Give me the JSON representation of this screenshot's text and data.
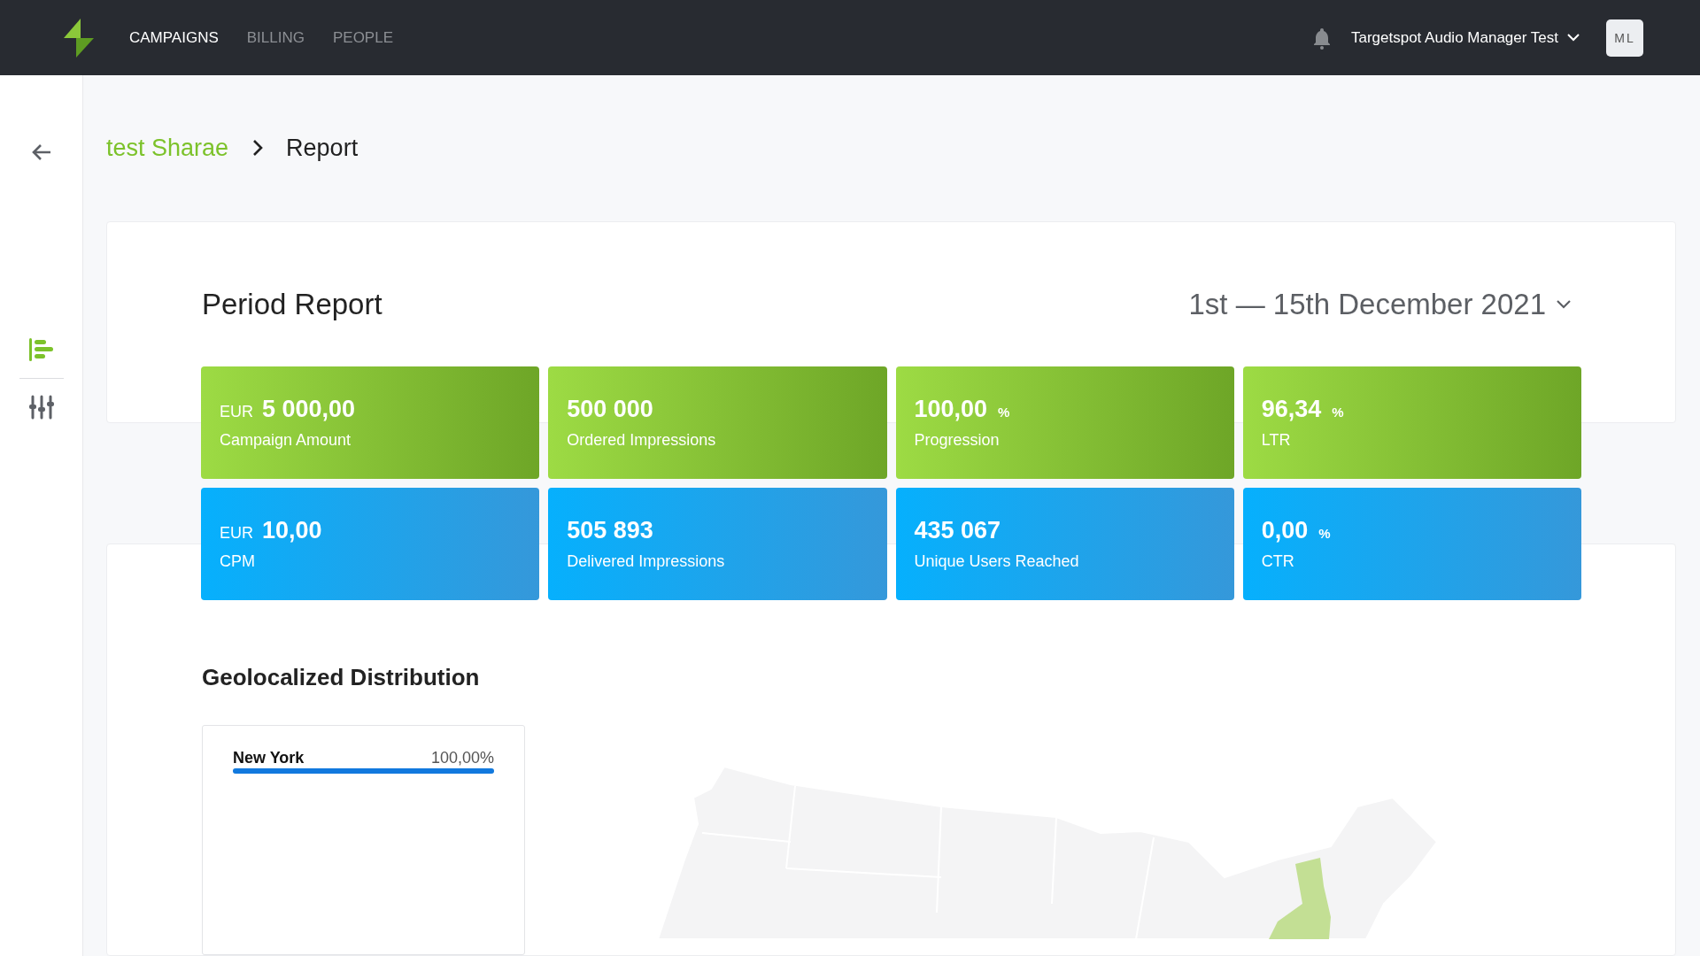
{
  "top_nav": {
    "tabs": [
      {
        "label": "CAMPAIGNS",
        "selected": true
      },
      {
        "label": "BILLING",
        "selected": false
      },
      {
        "label": "PEOPLE",
        "selected": false
      }
    ],
    "account": "Targetspot Audio Manager Test",
    "avatar": "ML"
  },
  "sidebar": {
    "items": [
      {
        "kind": "report",
        "selected": true
      },
      {
        "kind": "settings",
        "selected": false
      }
    ]
  },
  "breadcrumb": {
    "parent": "test Sharae",
    "current": "Report"
  },
  "period_report": {
    "title": "Period Report",
    "date_range": "1st — 15th December 2021"
  },
  "stat_rows": [
    {
      "kind": "goal",
      "tiles": [
        {
          "currency": "EUR",
          "value": "5 000,00",
          "label": "Campaign Amount"
        },
        {
          "value": "500 000",
          "label": "Ordered Impressions"
        },
        {
          "value": "100,00",
          "unit": "%",
          "label": "Progression"
        },
        {
          "value": "96,34",
          "unit": "%",
          "label": "LTR"
        }
      ]
    },
    {
      "kind": "delivery",
      "tiles": [
        {
          "currency": "EUR",
          "value": "10,00",
          "label": "CPM"
        },
        {
          "value": "505 893",
          "label": "Delivered Impressions"
        },
        {
          "value": "435 067",
          "label": "Unique Users Reached"
        },
        {
          "value": "0,00",
          "unit": "%",
          "label": "CTR"
        }
      ]
    }
  ],
  "geo": {
    "title": "Geolocalized Distribution",
    "regions": [
      {
        "name": "New York",
        "share": "100,00%",
        "level": 1
      }
    ]
  }
}
